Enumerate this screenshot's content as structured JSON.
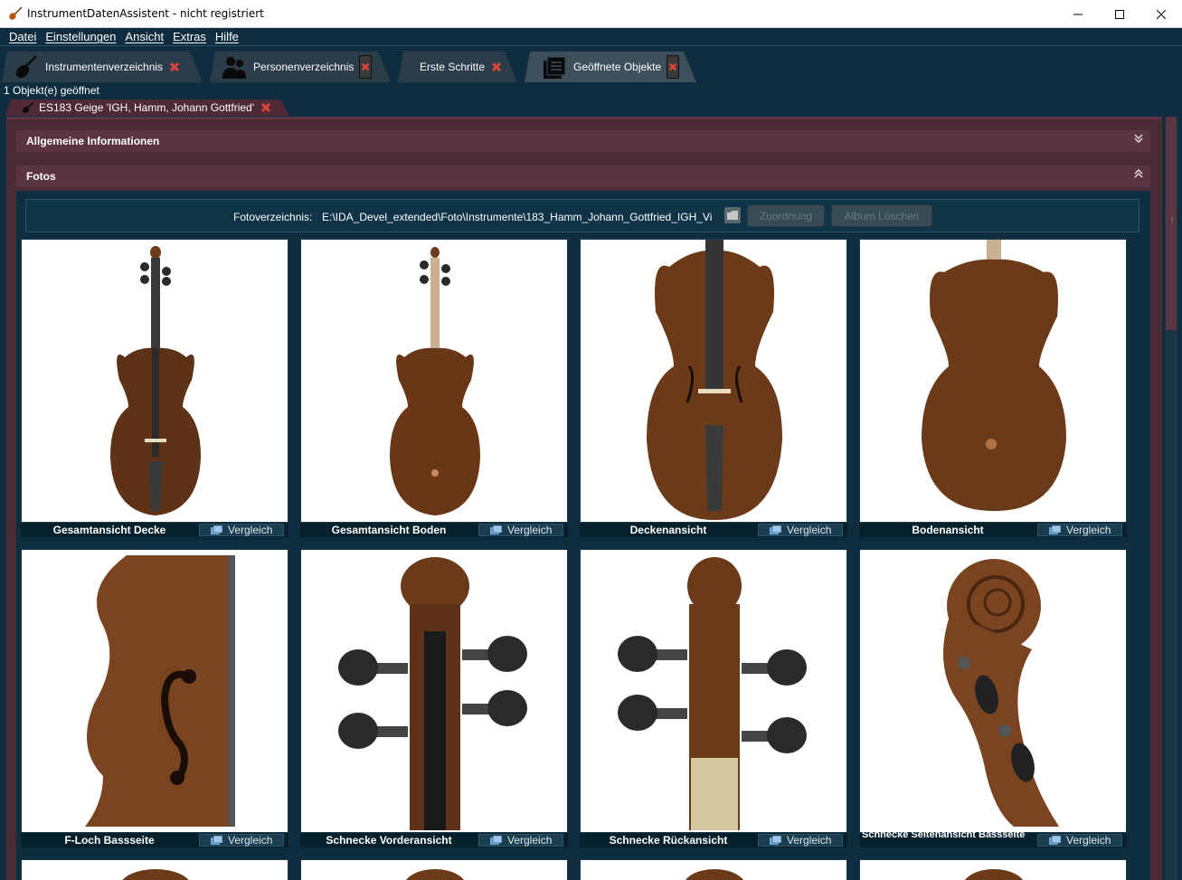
{
  "window": {
    "title": "InstrumentDatenAssistent - nicht registriert",
    "controls": [
      "minimize-icon",
      "maximize-icon",
      "close-icon"
    ]
  },
  "menu": [
    "Datei",
    "Einstellungen",
    "Ansicht",
    "Extras",
    "Hilfe"
  ],
  "main_tabs": [
    {
      "label": "Instrumentenverzeichnis",
      "icon": "violin-icon"
    },
    {
      "label": "Personenverzeichnis",
      "icon": "persons-icon"
    },
    {
      "label": "Erste Schritte",
      "icon": ""
    },
    {
      "label": "Geöffnete Objekte",
      "icon": "documents-icon",
      "active": true
    }
  ],
  "open_count": "1 Objekt(e) geöffnet",
  "object_tab": {
    "label": "ES183 Geige 'IGH, Hamm, Johann Gottfried'"
  },
  "sections": {
    "general": "Allgemeine Informationen",
    "fotos": "Fotos"
  },
  "fotos": {
    "path_label": "Fotoverzeichnis:",
    "path_value": "E:\\IDA_Devel_extended\\Foto\\Instrumente\\183_Hamm_Johann_Gottfried_IGH_Vi",
    "assign_button": "Zuordnung",
    "delete_album_button": "Album Löschen",
    "compare_label": "Vergleich",
    "photos": [
      {
        "caption": "Gesamtansicht Decke"
      },
      {
        "caption": "Gesamtansicht Boden"
      },
      {
        "caption": "Deckenansicht"
      },
      {
        "caption": "Bodenansicht"
      },
      {
        "caption": "F-Loch Bassseite"
      },
      {
        "caption": "Schnecke Vorderansicht"
      },
      {
        "caption": "Schnecke Rückansicht"
      },
      {
        "caption": "Schnecke Seitenansicht Bassseite"
      }
    ]
  },
  "colors": {
    "background": "#0e2d3e",
    "panel": "#4a2b36",
    "section_header": "#5a3441",
    "close_red": "#e0453a",
    "wood": "#6b3b1c"
  }
}
